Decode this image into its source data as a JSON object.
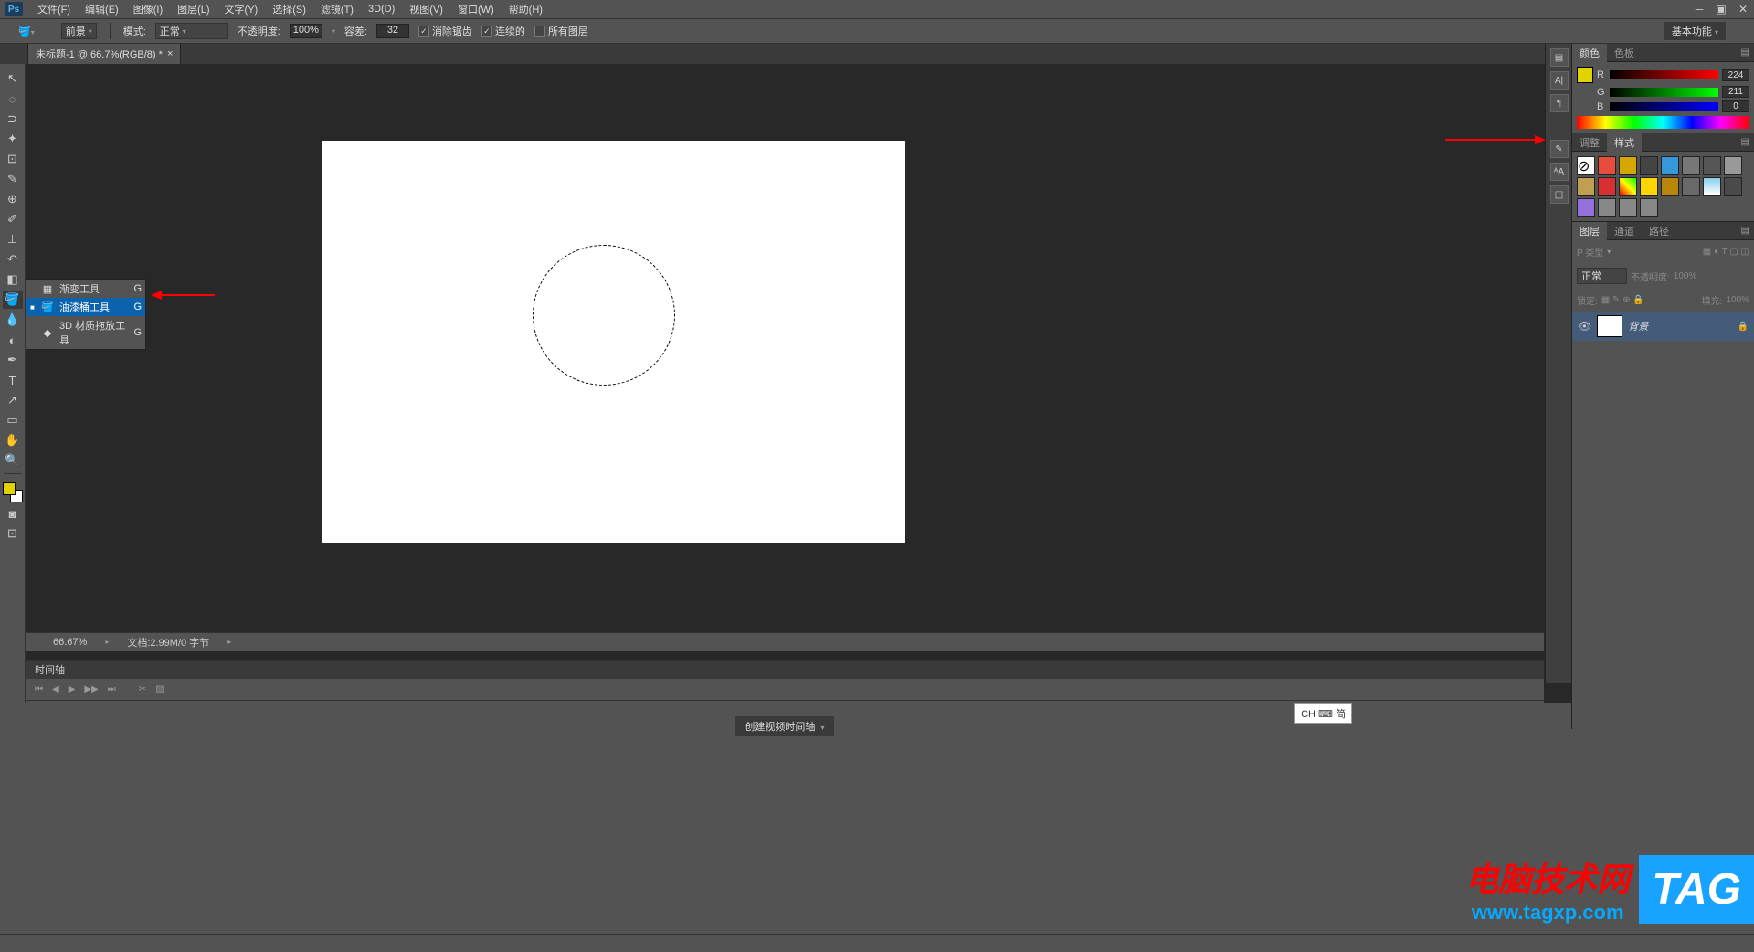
{
  "menubar": {
    "items": [
      "文件(F)",
      "编辑(E)",
      "图像(I)",
      "图层(L)",
      "文字(Y)",
      "选择(S)",
      "滤镜(T)",
      "3D(D)",
      "视图(V)",
      "窗口(W)",
      "帮助(H)"
    ]
  },
  "optionsbar": {
    "fill_label": "前景",
    "mode_label": "模式:",
    "mode_value": "正常",
    "opacity_label": "不透明度:",
    "opacity_value": "100%",
    "tolerance_label": "容差:",
    "tolerance_value": "32",
    "antialias": "消除锯齿",
    "contiguous": "连续的",
    "alllayers": "所有图层",
    "workspace": "基本功能"
  },
  "doctab": {
    "title": "未标题-1 @ 66.7%(RGB/8) *"
  },
  "flyout": {
    "items": [
      {
        "label": "渐变工具",
        "key": "G"
      },
      {
        "label": "油漆桶工具",
        "key": "G"
      },
      {
        "label": "3D 材质拖放工具",
        "key": "G"
      }
    ]
  },
  "statusbar": {
    "zoom": "66.67%",
    "docinfo": "文档:2.99M/0 字节"
  },
  "timeline": {
    "title": "时间轴",
    "create_btn": "创建视频时间轴"
  },
  "panels": {
    "color_tab": "颜色",
    "swatches_tab": "色板",
    "r": "224",
    "g": "211",
    "b": "0",
    "adjust_tab": "调整",
    "styles_tab": "样式",
    "layers_tab": "图层",
    "channels_tab": "通道",
    "paths_tab": "路径",
    "blend_mode": "正常",
    "opacity_label": "不透明度:",
    "opacity_val": "100%",
    "lock_label": "锁定:",
    "fill_label": "填充:",
    "fill_val": "100%",
    "kind_label": "P 类型",
    "layer_name": "背景"
  },
  "ime": "CH ⌨ 简",
  "watermark": {
    "cn": "电脑技术网",
    "url": "www.tagxp.com",
    "tag": "TAG"
  }
}
